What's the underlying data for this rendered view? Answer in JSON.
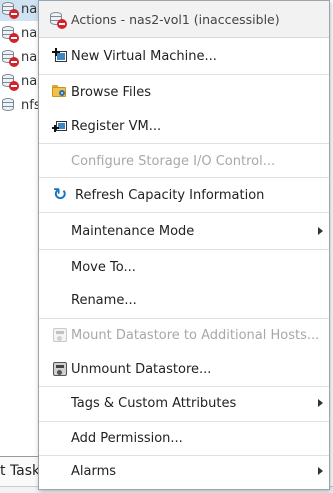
{
  "tree": {
    "items": [
      {
        "label": "nas",
        "error": true,
        "selected": true
      },
      {
        "label": "nas",
        "error": true,
        "selected": false
      },
      {
        "label": "nas",
        "error": true,
        "selected": false
      },
      {
        "label": "nas",
        "error": true,
        "selected": false
      },
      {
        "label": "nfs",
        "error": false,
        "selected": false
      }
    ]
  },
  "bottom_tab": {
    "label": "t Task"
  },
  "menu": {
    "header": {
      "title": "Actions - nas2-vol1 (inaccessible)",
      "icon": "datastore-error-icon"
    },
    "items": {
      "new_vm": {
        "label": "New Virtual Machine...",
        "icon": "new-vm-icon"
      },
      "browse_files": {
        "label": "Browse Files",
        "icon": "folder-search-icon"
      },
      "register_vm": {
        "label": "Register VM...",
        "icon": "register-vm-icon"
      },
      "configure_sioc": {
        "label": "Configure Storage I/O Control...",
        "disabled": true
      },
      "refresh_capacity": {
        "label": "Refresh Capacity Information",
        "icon": "refresh-icon"
      },
      "maintenance_mode": {
        "label": "Maintenance Mode",
        "submenu": true
      },
      "move_to": {
        "label": "Move To..."
      },
      "rename": {
        "label": "Rename..."
      },
      "mount_datastore": {
        "label": "Mount Datastore to Additional Hosts...",
        "icon": "mount-datastore-icon",
        "disabled": true
      },
      "unmount_datastore": {
        "label": "Unmount Datastore...",
        "icon": "unmount-datastore-icon"
      },
      "tags": {
        "label": "Tags & Custom Attributes",
        "submenu": true
      },
      "add_permission": {
        "label": "Add Permission..."
      },
      "alarms": {
        "label": "Alarms",
        "submenu": true
      }
    }
  },
  "colors": {
    "refresh_icon": "#1a74c4",
    "error_badge": "#d2232a",
    "disabled_text": "#a8a8a8"
  }
}
